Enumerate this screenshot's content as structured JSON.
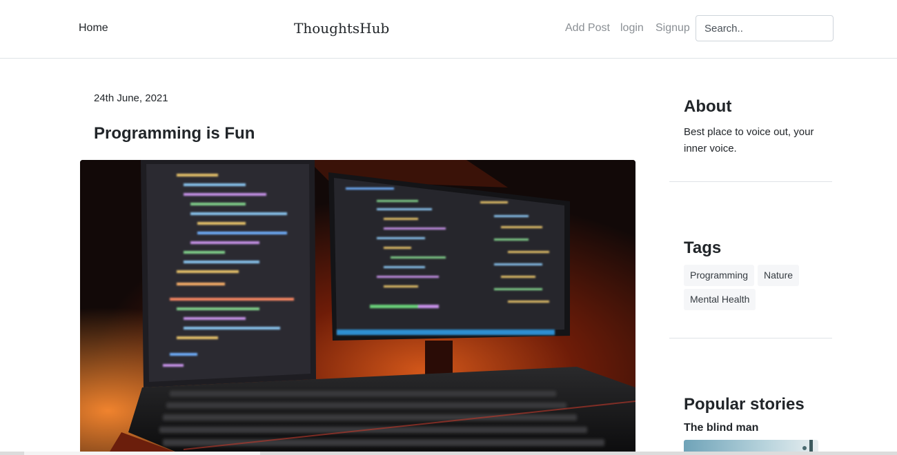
{
  "nav": {
    "home": "Home",
    "brand": "ThoughtsHub",
    "add_post": "Add Post",
    "login": "login",
    "signup": "Signup",
    "search_placeholder": "Search.."
  },
  "post": {
    "date": "24th June, 2021",
    "title": "Programming is Fun",
    "image_icon": "laptop-code-photo"
  },
  "sidebar": {
    "about": {
      "heading": "About",
      "text": "Best place to voice out, your inner voice."
    },
    "tags": {
      "heading": "Tags",
      "items": [
        "Programming",
        "Nature",
        "Mental Health"
      ]
    },
    "popular": {
      "heading": "Popular stories",
      "stories": [
        {
          "title": "The blind man"
        }
      ]
    }
  },
  "colors": {
    "nav_link_muted": "#8a8f94",
    "text": "#212529",
    "tag_bg": "#f5f6f8",
    "border": "#dee2e6"
  }
}
